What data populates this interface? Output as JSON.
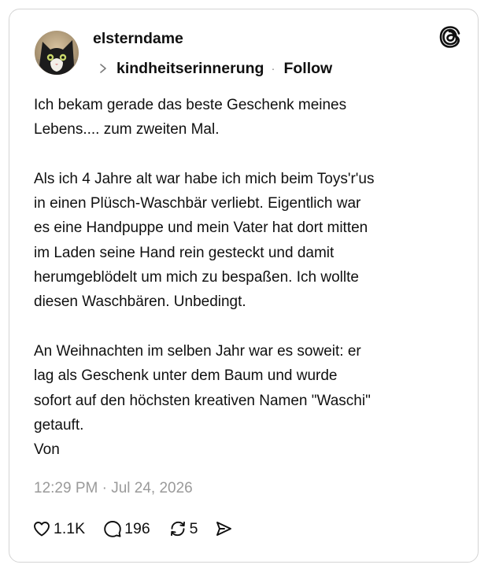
{
  "post": {
    "author": "elsterndame",
    "topic": "kindheitserinnerung",
    "separator": "·",
    "follow_label": "Follow",
    "body": "Ich bekam gerade das beste Geschenk meines\nLebens.... zum zweiten Mal.\n\nAls ich 4 Jahre alt war habe ich mich beim Toys'r'us\nin einen Plüsch-Waschbär verliebt. Eigentlich war\nes eine Handpuppe und mein Vater hat dort mitten\nim Laden seine Hand rein gesteckt und damit\nherumgeblödelt um mich zu bespaßen. Ich wollte\ndiesen Waschbären. Unbedingt.\n\nAn Weihnachten im selben Jahr war es soweit: er\nlag als Geschenk unter dem Baum und wurde\nsofort auf den höchsten kreativen Namen \"Waschi\"\ngetauft.\nVon",
    "timestamp": "12:29 PM · Jul 24, 2026"
  },
  "actions": {
    "likes": "1.1K",
    "replies": "196",
    "reposts": "5"
  },
  "icons": {
    "logo": "threads-logo-icon",
    "like": "heart-icon",
    "reply": "speech-bubble-icon",
    "repost": "repost-arrows-icon",
    "share": "send-icon",
    "topic": "chevron-right-icon"
  },
  "colors": {
    "text": "#101010",
    "muted": "#9a9a9a",
    "border": "#d4d4d4"
  }
}
